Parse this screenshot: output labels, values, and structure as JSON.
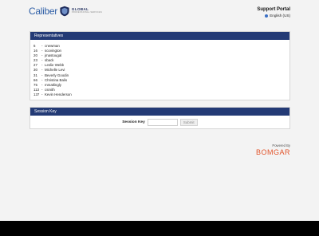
{
  "header": {
    "logo_brand": "Caliber",
    "logo_global": "GLOBAL",
    "logo_tagline": "PROFESSIONAL SERVICES",
    "portal_title": "Support Portal",
    "language": "English (US)",
    "language_icon": "globe-icon"
  },
  "representatives": {
    "title": "Representatives",
    "items": [
      {
        "id": "6",
        "name": "cnewman"
      },
      {
        "id": "16",
        "name": "scovington"
      },
      {
        "id": "20",
        "name": "jmastougal"
      },
      {
        "id": "23",
        "name": "sback"
      },
      {
        "id": "27",
        "name": "Leslie Webb"
      },
      {
        "id": "30",
        "name": "Michelle Levi"
      },
      {
        "id": "31",
        "name": "Beverly Goodin"
      },
      {
        "id": "66",
        "name": "Christina Balis"
      },
      {
        "id": "75",
        "name": "mmatlingly"
      },
      {
        "id": "113",
        "name": "csmith"
      },
      {
        "id": "137",
        "name": "Kevin Henderson"
      }
    ]
  },
  "session": {
    "title": "Session Key",
    "label": "Session Key",
    "input_value": "",
    "submit_label": "Submit"
  },
  "footer_brand": {
    "powered_by": "Powered By",
    "name": "BOMGAR"
  },
  "colors": {
    "panel_header": "#233a75",
    "brand_orange": "#e2542b",
    "logo_blue": "#2f5fa7"
  }
}
